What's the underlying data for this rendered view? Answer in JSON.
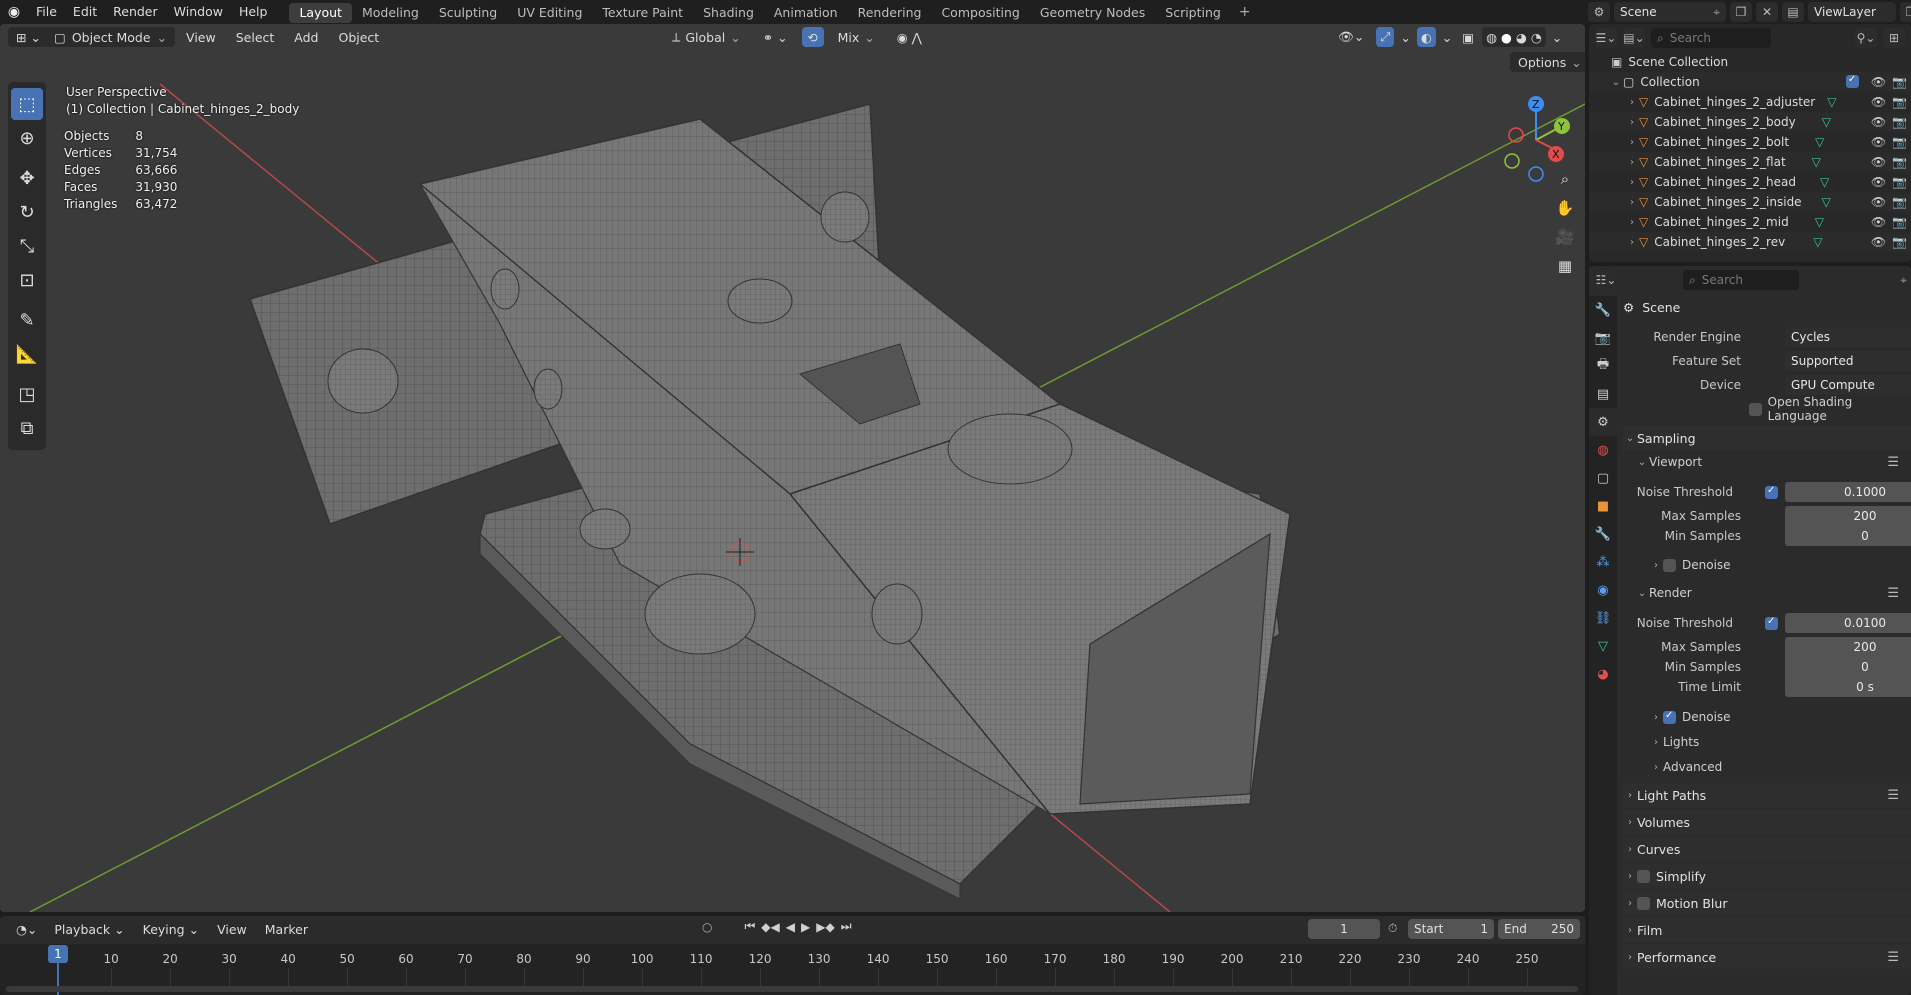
{
  "topbar": {
    "menus": [
      "File",
      "Edit",
      "Render",
      "Window",
      "Help"
    ],
    "workspaces": [
      "Layout",
      "Modeling",
      "Sculpting",
      "UV Editing",
      "Texture Paint",
      "Shading",
      "Animation",
      "Rendering",
      "Compositing",
      "Geometry Nodes",
      "Scripting"
    ],
    "active_workspace": "Layout",
    "scene_name": "Scene",
    "view_layer": "ViewLayer"
  },
  "viewport": {
    "mode": "Object Mode",
    "menus": [
      "View",
      "Select",
      "Add",
      "Object"
    ],
    "transform_orientation": "Global",
    "snap_mode": "Mix",
    "options_label": "Options",
    "perspective_label": "User Perspective",
    "active_info": "(1) Collection | Cabinet_hinges_2_body",
    "stats": [
      {
        "label": "Objects",
        "value": "8"
      },
      {
        "label": "Vertices",
        "value": "31,754"
      },
      {
        "label": "Edges",
        "value": "63,666"
      },
      {
        "label": "Faces",
        "value": "31,930"
      },
      {
        "label": "Triangles",
        "value": "63,472"
      }
    ],
    "gizmo_axes": [
      "X",
      "Y",
      "Z"
    ],
    "colors": {
      "x_axis": "#e44a4a",
      "y_axis": "#8fc43a",
      "z_axis": "#3c8ff0",
      "background": "#3a3a3a"
    }
  },
  "outliner": {
    "search_placeholder": "Search",
    "root": "Scene Collection",
    "collection": "Collection",
    "objects": [
      "Cabinet_hinges_2_adjuster",
      "Cabinet_hinges_2_body",
      "Cabinet_hinges_2_bolt",
      "Cabinet_hinges_2_flat",
      "Cabinet_hinges_2_head",
      "Cabinet_hinges_2_inside",
      "Cabinet_hinges_2_mid",
      "Cabinet_hinges_2_rev"
    ]
  },
  "properties": {
    "search_placeholder": "Search",
    "context": "Scene",
    "render_engine": {
      "label": "Render Engine",
      "value": "Cycles"
    },
    "feature_set": {
      "label": "Feature Set",
      "value": "Supported"
    },
    "device": {
      "label": "Device",
      "value": "GPU Compute"
    },
    "osl": "Open Shading Language",
    "sampling": "Sampling",
    "viewport_panel": "Viewport",
    "render_panel": "Render",
    "vp_noise_threshold": {
      "label": "Noise Threshold",
      "value": "0.1000"
    },
    "vp_max_samples": {
      "label": "Max Samples",
      "value": "200"
    },
    "vp_min_samples": {
      "label": "Min Samples",
      "value": "0"
    },
    "denoise": "Denoise",
    "r_noise_threshold": {
      "label": "Noise Threshold",
      "value": "0.0100"
    },
    "r_max_samples": {
      "label": "Max Samples",
      "value": "200"
    },
    "r_min_samples": {
      "label": "Min Samples",
      "value": "0"
    },
    "time_limit": {
      "label": "Time Limit",
      "value": "0 s"
    },
    "lights": "Lights",
    "advanced": "Advanced",
    "sections": [
      "Light Paths",
      "Volumes",
      "Curves",
      "Simplify",
      "Motion Blur",
      "Film",
      "Performance"
    ]
  },
  "timeline": {
    "menus": [
      "Playback",
      "Keying",
      "View",
      "Marker"
    ],
    "current_frame": "1",
    "start_label": "Start",
    "start": "1",
    "end_label": "End",
    "end": "250",
    "ticks": [
      "1",
      "10",
      "20",
      "30",
      "40",
      "50",
      "60",
      "70",
      "80",
      "90",
      "100",
      "110",
      "120",
      "130",
      "140",
      "150",
      "160",
      "170",
      "180",
      "190",
      "200",
      "210",
      "220",
      "230",
      "240",
      "250"
    ]
  }
}
